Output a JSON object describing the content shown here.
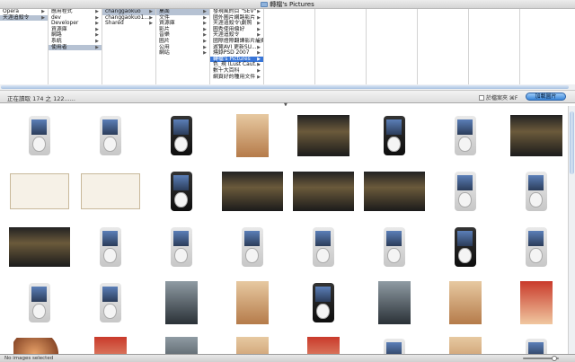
{
  "window": {
    "title": "轉檔's Pictures"
  },
  "browser": {
    "col1": [
      {
        "label": "Opera",
        "state": "normal",
        "arrow": true
      },
      {
        "label": "天涯追殺令",
        "state": "sel",
        "arrow": true
      }
    ],
    "col2": [
      {
        "label": "應用程式",
        "state": "normal",
        "arrow": true
      },
      {
        "label": "dev",
        "state": "normal",
        "arrow": true
      },
      {
        "label": "Developer",
        "state": "normal",
        "arrow": true
      },
      {
        "label": "資源庫",
        "state": "normal",
        "arrow": true
      },
      {
        "label": "網路",
        "state": "normal",
        "arrow": true
      },
      {
        "label": "系統",
        "state": "normal",
        "arrow": true
      },
      {
        "label": "使用者",
        "state": "sel",
        "arrow": true
      }
    ],
    "col3": [
      {
        "label": "changgaokuo",
        "state": "sel",
        "arrow": true
      },
      {
        "label": "changgaokuo1...",
        "state": "normal",
        "arrow": true
      },
      {
        "label": "Shared",
        "state": "normal",
        "arrow": true
      }
    ],
    "col4": [
      {
        "label": "桌面",
        "state": "sel",
        "arrow": true
      },
      {
        "label": "文件",
        "state": "normal",
        "arrow": true
      },
      {
        "label": "資源庫",
        "state": "normal",
        "arrow": true
      },
      {
        "label": "影片",
        "state": "normal",
        "arrow": true
      },
      {
        "label": "音樂",
        "state": "normal",
        "arrow": true
      },
      {
        "label": "圖片",
        "state": "normal",
        "arrow": true
      },
      {
        "label": "公用",
        "state": "normal",
        "arrow": true
      },
      {
        "label": "網站",
        "state": "normal",
        "arrow": true
      }
    ],
    "col5": [
      {
        "label": "發現風的目 \"SEV\"",
        "state": "normal",
        "arrow": true
      },
      {
        "label": "國外圖片網路影片",
        "state": "normal",
        "arrow": true
      },
      {
        "label": "天涯追殺令\\劇照",
        "state": "normal",
        "arrow": true
      },
      {
        "label": "圖秀使用偏好",
        "state": "normal",
        "arrow": true
      },
      {
        "label": "天涯追殺令",
        "state": "normal",
        "arrow": true
      },
      {
        "label": "國際燈際翻譯影片組費",
        "state": "normal",
        "arrow": true
      },
      {
        "label": "遊覽AVI 更新SU...",
        "state": "normal",
        "arrow": true
      },
      {
        "label": "燒錄PSD 2007",
        "state": "normal",
        "arrow": true
      },
      {
        "label": "轉檔's Pictures",
        "state": "active",
        "arrow": true
      },
      {
        "label": "色_現 (Lust Caut...",
        "state": "normal",
        "arrow": true
      },
      {
        "label": "數十大百科",
        "state": "normal",
        "arrow": true
      },
      {
        "label": "網頁好的種用文件",
        "state": "normal",
        "arrow": true
      }
    ]
  },
  "infobar": {
    "status": "正在讀取 174 之 122......",
    "checkbox_label": "於檔案夾 ⌘F",
    "import_label": "加載圖片"
  },
  "grid": {
    "rows": [
      [
        "ipod-silver",
        "ipod-silver",
        "ipod-black",
        "poster",
        "screen",
        "ipod-black",
        "ipod-silver",
        "screen"
      ],
      [
        "sketch",
        "sketch",
        "ipod-black",
        "screen",
        "screen",
        "screen",
        "ipod-silver",
        "ipod-silver"
      ],
      [
        "screen",
        "ipod-silver",
        "ipod-silver",
        "ipod-silver",
        "ipod-silver",
        "ipod-silver",
        "ipod-black",
        "ipod-silver"
      ],
      [
        "ipod-silver",
        "ipod-silver",
        "poster3",
        "poster",
        "ipod-black",
        "poster3",
        "poster",
        "poster2"
      ],
      [
        "planet",
        "poster2",
        "poster3",
        "poster",
        "poster2",
        "ipod-silver",
        "poster",
        "ipod-silver"
      ]
    ]
  },
  "bottombar": {
    "status": "No images selected"
  }
}
